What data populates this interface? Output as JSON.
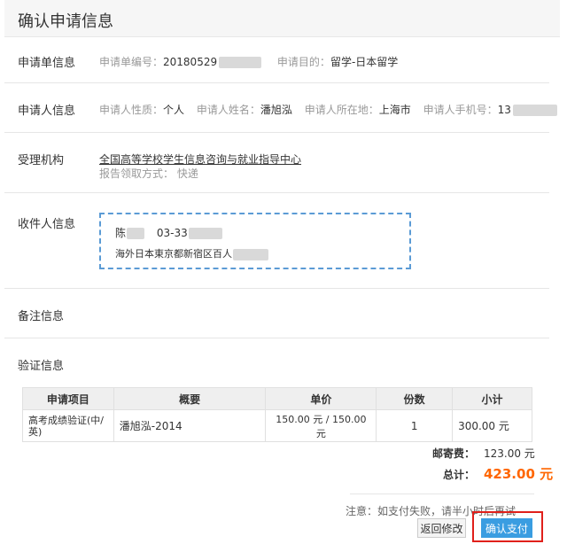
{
  "header": {
    "title": "确认申请信息"
  },
  "application": {
    "label": "申请单信息",
    "number_label": "申请单编号：",
    "number_value": "20180529",
    "purpose_label": "申请目的：",
    "purpose_value": "留学-日本留学"
  },
  "applicant": {
    "label": "申请人信息",
    "type_label": "申请人性质：",
    "type_value": "个人",
    "name_label": "申请人姓名：",
    "name_value": "潘旭泓",
    "location_label": "申请人所在地：",
    "location_value": "上海市",
    "phone_label": "申请人手机号：",
    "phone_value": "13"
  },
  "agency": {
    "label": "受理机构",
    "name": "全国高等学校学生信息咨询与就业指导中心",
    "delivery": "报告领取方式： 快递"
  },
  "recipient": {
    "label": "收件人信息",
    "name": "陈",
    "phone": "03-33",
    "address": "海外日本東京都新宿区百人"
  },
  "remarks": {
    "label": "备注信息"
  },
  "verification": {
    "label": "验证信息"
  },
  "table": {
    "headers": [
      "申请项目",
      "概要",
      "单价",
      "份数",
      "小计"
    ],
    "rows": [
      {
        "item": "高考成绩验证(中/英)",
        "summary": "潘旭泓-2014",
        "price": "150.00 元 / 150.00 元",
        "qty": "1",
        "subtotal": "300.00 元"
      }
    ]
  },
  "summary": {
    "postage_label": "邮寄费：",
    "postage_value": "123.00 元",
    "total_label": "总计：",
    "total_value": "423.00 元"
  },
  "note": "注意：如支付失败，请半小时后再试",
  "buttons": {
    "back": "返回修改",
    "pay": "确认支付"
  },
  "colors": {
    "accent": "#3a9de1",
    "total": "#ff6600",
    "highlight": "#e0201b"
  }
}
